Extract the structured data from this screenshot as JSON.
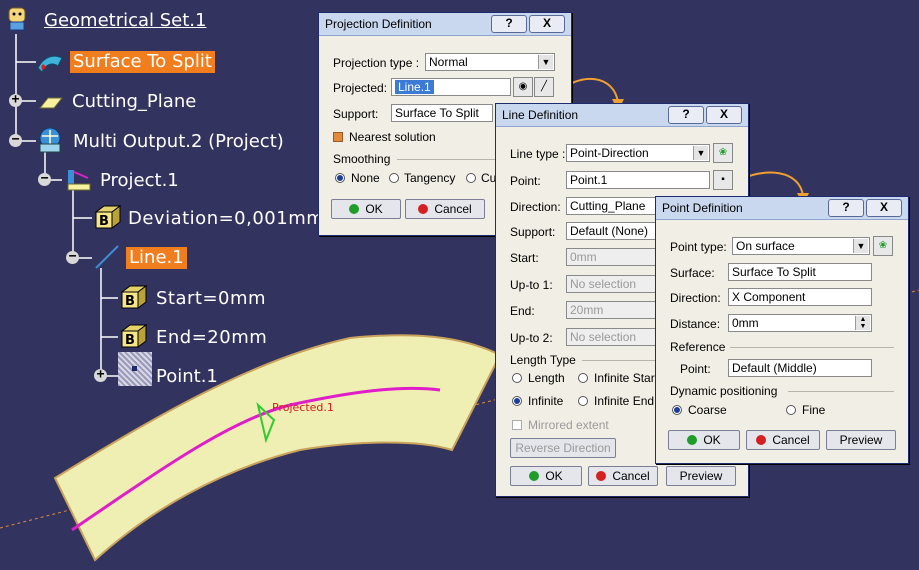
{
  "tree": {
    "root": "Geometrical Set.1",
    "surface_to_split": "Surface To Split",
    "cutting_plane": "Cutting_Plane",
    "multi_output": "Multi Output.2 (Project)",
    "project": "Project.1",
    "deviation": "Deviation=0,001mm",
    "line": "Line.1",
    "start": "Start=0mm",
    "end": "End=20mm",
    "point": "Point.1"
  },
  "viewport": {
    "label": "Projected.1"
  },
  "projection_dialog": {
    "title": "Projection Definition",
    "help": "?",
    "close": "X",
    "projection_type_label": "Projection type :",
    "projection_type_value": "Normal",
    "projected_label": "Projected:",
    "projected_value": "Line.1",
    "support_label": "Support:",
    "support_value": "Surface To Split",
    "nearest_solution": "Nearest solution",
    "smoothing_label": "Smoothing",
    "smoothing_none": "None",
    "smoothing_tangency": "Tangency",
    "smoothing_cu": "Cu",
    "ok": "OK",
    "cancel": "Cancel"
  },
  "line_dialog": {
    "title": "Line Definition",
    "help": "?",
    "close": "X",
    "line_type_label": "Line type :",
    "line_type_value": "Point-Direction",
    "point_label": "Point:",
    "point_value": "Point.1",
    "direction_label": "Direction:",
    "direction_value": "Cutting_Plane",
    "support_label": "Support:",
    "support_value": "Default (None)",
    "start_label": "Start:",
    "start_value": "0mm",
    "upto1_label": "Up-to 1:",
    "upto1_value": "No selection",
    "end_label": "End:",
    "end_value": "20mm",
    "upto2_label": "Up-to 2:",
    "upto2_value": "No selection",
    "length_type_label": "Length Type",
    "length": "Length",
    "infinite_start": "Infinite Star",
    "infinite": "Infinite",
    "infinite_end": "Infinite End",
    "mirrored_extent": "Mirrored extent",
    "reverse_direction": "Reverse Direction",
    "ok": "OK",
    "cancel": "Cancel",
    "preview": "Preview"
  },
  "point_dialog": {
    "title": "Point Definition",
    "help": "?",
    "close": "X",
    "point_type_label": "Point type:",
    "point_type_value": "On surface",
    "surface_label": "Surface:",
    "surface_value": "Surface To Split",
    "direction_label": "Direction:",
    "direction_value": "X Component",
    "distance_label": "Distance:",
    "distance_value": "0mm",
    "reference_label": "Reference",
    "ref_point_label": "Point:",
    "ref_point_value": "Default (Middle)",
    "dynamic_positioning_label": "Dynamic positioning",
    "coarse": "Coarse",
    "fine": "Fine",
    "ok": "OK",
    "cancel": "Cancel",
    "preview": "Preview"
  },
  "colors": {
    "background": "#33335f",
    "selection": "#f07d1e",
    "surface": "#efefb4",
    "curve": "#e01ec8",
    "arrow": "#f0a030",
    "ok_green": "#1f9d2a",
    "cancel_red": "#d42020"
  }
}
